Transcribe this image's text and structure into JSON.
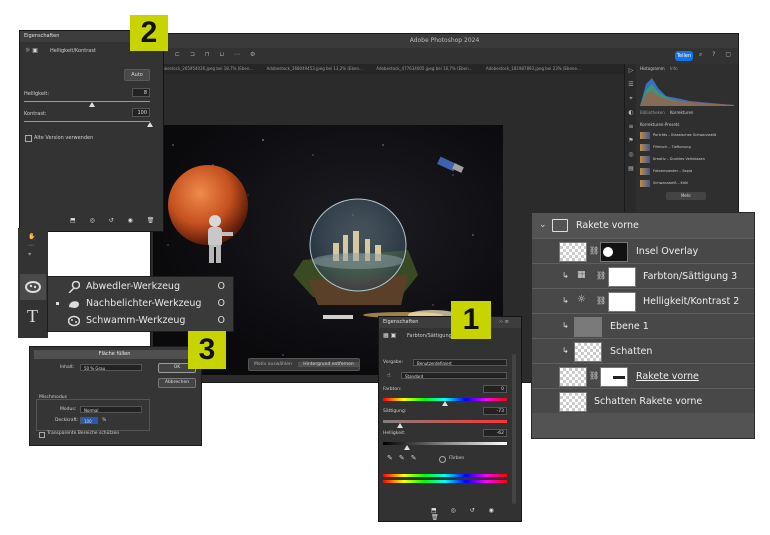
{
  "app_title": "Adobe Photoshop 2024",
  "share_label": "Teilen",
  "tabs": [
    "Adobestock_265954026.jpeg bei 18,7% (Eben…",
    "Adobestock_368049453.jpeg bei 13,2% (Eben…",
    "Adobestock_477634005.jpeg bei 16,7% (Eben…",
    "Adobestock_181987893.jpeg bei 23% (Ebene…"
  ],
  "right_panels": {
    "histogram_tabs": [
      "Histogramm",
      "Info"
    ],
    "lib_tabs": [
      "Bibliotheken",
      "Korrekturen"
    ],
    "presets_header": "Korrekturen-Presets",
    "presets": [
      "Porträts – Klassisches Schwarzweiß",
      "Filmisch – Tieftonung",
      "Kreativ – Dunkles Verblassen",
      "Fotoempexter – Sepia",
      "Schwarzweiß – Kühl"
    ],
    "more_label": "Mehr"
  },
  "properties_brightness": {
    "title": "Eigenschaften",
    "layer_type": "Helligkeit/Kontrast",
    "auto_label": "Auto",
    "brightness_label": "Helligkeit:",
    "brightness_value": "8",
    "contrast_label": "Kontrast:",
    "contrast_value": "100",
    "legacy_label": "Alte Version verwenden",
    "brightness_pct": 0.54,
    "contrast_pct": 1.0
  },
  "badges": {
    "b1": "1",
    "b2": "2",
    "b3": "3"
  },
  "layers": {
    "group_name": "Rakete vorne",
    "rows": [
      {
        "name": "Insel Overlay"
      },
      {
        "name": "Farbton/Sättigung 3"
      },
      {
        "name": "Helligkeit/Kontrast 2"
      },
      {
        "name": "Ebene 1"
      },
      {
        "name": "Schatten"
      },
      {
        "name": "Rakete vorne"
      },
      {
        "name": "Schatten Rakete vorne"
      }
    ]
  },
  "tool_flyout": {
    "items": [
      {
        "label": "Abwedler-Werkzeug",
        "shortcut": "O"
      },
      {
        "label": "Nachbelichter-Werkzeug",
        "shortcut": "O"
      },
      {
        "label": "Schwamm-Werkzeug",
        "shortcut": "O"
      }
    ]
  },
  "fill_dialog": {
    "title": "Fläche füllen",
    "content_label": "Inhalt:",
    "content_value": "50 % Grau",
    "ok_label": "OK",
    "cancel_label": "Abbrechen",
    "blend_header": "Mischmodus",
    "mode_label": "Modus:",
    "mode_value": "Normal",
    "opacity_label": "Deckkraft:",
    "opacity_value": "100",
    "opacity_unit": "%",
    "transparent_label": "Transparente Bereiche schützen"
  },
  "properties_hue": {
    "title": "Eigenschaften",
    "layer_type": "Farbton/Sättigung",
    "preset_label": "Vorgabe:",
    "preset_value": "Benutzerdefiniert",
    "channel_value": "Standard",
    "hue_label": "Farbton:",
    "hue_value": "0",
    "sat_label": "Sättigung:",
    "sat_value": "-73",
    "light_label": "Helligkeit:",
    "light_value": "-62",
    "colorize_label": "Färben",
    "hue_pct": 0.5,
    "sat_pct": 0.14,
    "light_pct": 0.19
  },
  "canvas_bar": {
    "subject_label": "Motiv auswählen",
    "remove_bg_label": "Hintergrund entfernen"
  },
  "colors": {
    "badge": "#c8d400",
    "accent": "#1473e6"
  }
}
